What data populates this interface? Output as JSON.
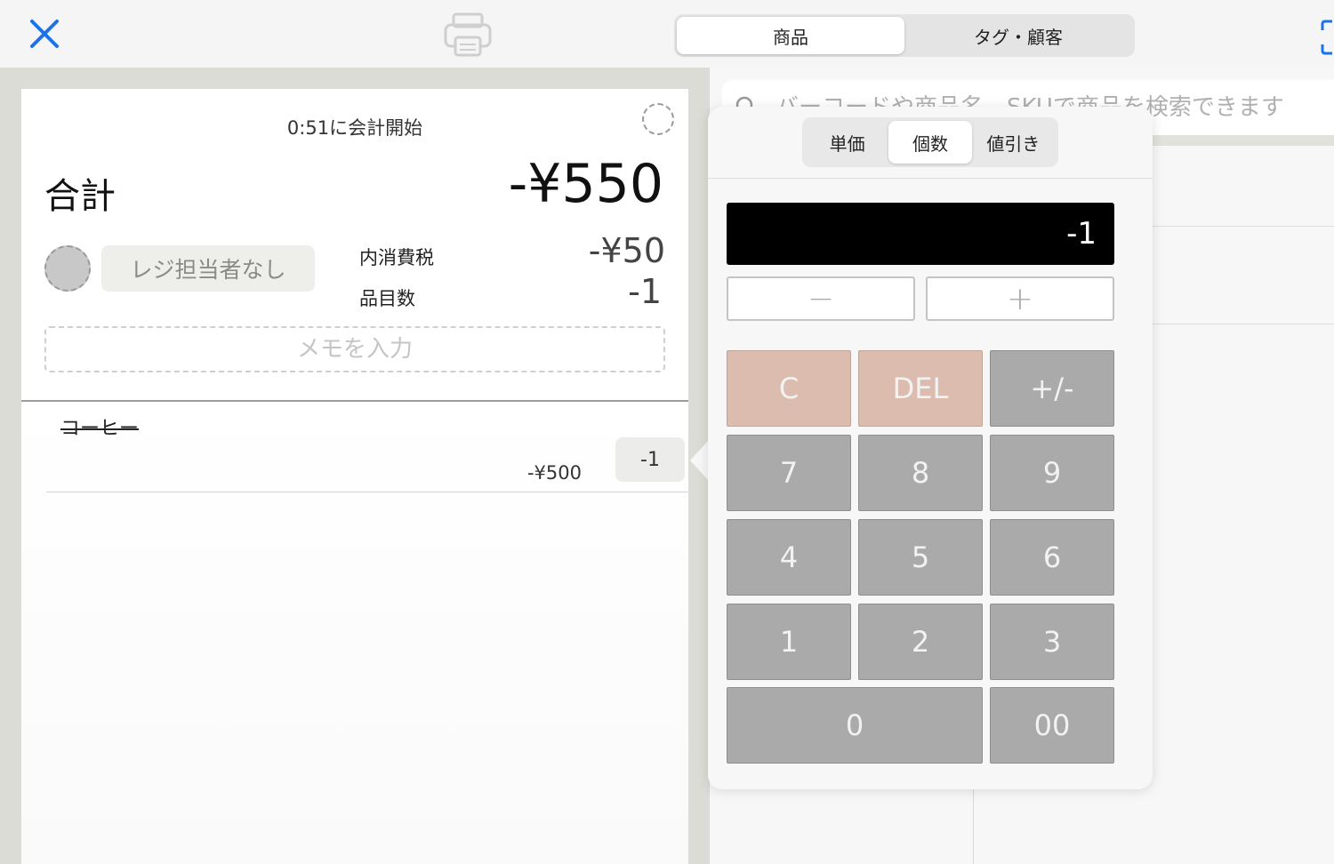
{
  "header": {
    "tabs": [
      {
        "label": "商品",
        "active": true
      },
      {
        "label": "タグ・顧客",
        "active": false
      }
    ],
    "close_icon": "close-x-icon",
    "print_icon": "printer-icon",
    "scan_icon": "scan-icon",
    "accent_color": "#1a73e8"
  },
  "order": {
    "start_time_text": "0:51に会計開始",
    "total_label": "合計",
    "total_value": "-¥550",
    "staff_label": "レジ担当者なし",
    "tax_label": "内消費税",
    "tax_value": "-¥50",
    "item_count_label": "品目数",
    "item_count_value": "-1",
    "memo_placeholder": "メモを入力",
    "items": [
      {
        "name": "コーヒー",
        "price": "-¥500",
        "quantity": "-1"
      }
    ]
  },
  "search": {
    "placeholder": "バーコードや商品名、SKUで商品を検索できます"
  },
  "keypad_popover": {
    "modes": [
      {
        "label": "単価",
        "active": false
      },
      {
        "label": "個数",
        "active": true
      },
      {
        "label": "値引き",
        "active": false
      }
    ],
    "display_value": "-1",
    "minus_label": "−",
    "plus_label": "+",
    "keys": {
      "clear": "C",
      "delete": "DEL",
      "sign": "+/-",
      "k7": "7",
      "k8": "8",
      "k9": "9",
      "k4": "4",
      "k5": "5",
      "k6": "6",
      "k1": "1",
      "k2": "2",
      "k3": "3",
      "k0": "0",
      "k00": "00"
    }
  }
}
